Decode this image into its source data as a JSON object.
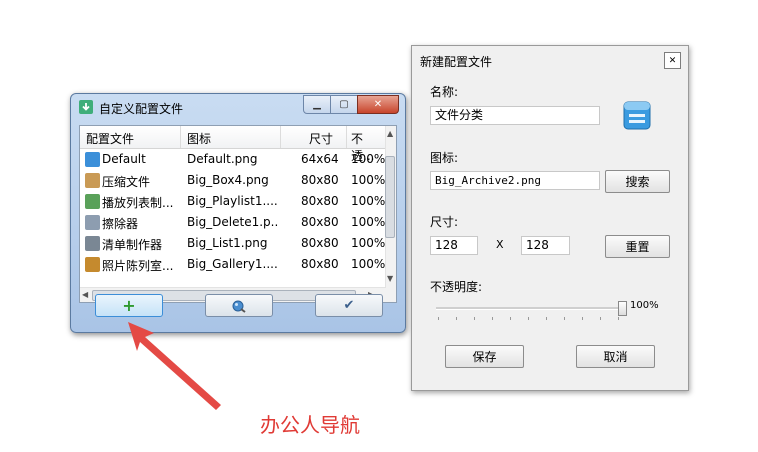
{
  "left_window": {
    "title": "自定义配置文件",
    "columns": [
      "配置文件",
      "图标",
      "尺寸",
      "不透..."
    ],
    "rows": [
      {
        "name": "Default",
        "icon_file": "Default.png",
        "size": "64x64",
        "opacity": "100%",
        "color": "#3b8fd9"
      },
      {
        "name": "压缩文件",
        "icon_file": "Big_Box4.png",
        "size": "80x80",
        "opacity": "100%",
        "color": "#c99a55"
      },
      {
        "name": "播放列表制...",
        "icon_file": "Big_Playlist1....",
        "size": "80x80",
        "opacity": "100%",
        "color": "#5aa15a"
      },
      {
        "name": "擦除器",
        "icon_file": "Big_Delete1.p...",
        "size": "80x80",
        "opacity": "100%",
        "color": "#8d9db0"
      },
      {
        "name": "清单制作器",
        "icon_file": "Big_List1.png",
        "size": "80x80",
        "opacity": "100%",
        "color": "#7a8794"
      },
      {
        "name": "照片陈列室...",
        "icon_file": "Big_Gallery1....",
        "size": "80x80",
        "opacity": "100%",
        "color": "#c58a2e"
      }
    ],
    "buttons": {
      "add": "+",
      "check": "✔"
    }
  },
  "dialog": {
    "title": "新建配置文件",
    "name_label": "名称:",
    "name_value": "文件分类",
    "icon_label": "图标:",
    "icon_value": "Big_Archive2.png",
    "search_button": "搜索",
    "size_label": "尺寸:",
    "width_value": "128",
    "x_sep": "X",
    "height_value": "128",
    "reset_button": "重置",
    "opacity_label": "不透明度:",
    "opacity_value": "100%",
    "opacity_level": 1.0,
    "save_button": "保存",
    "cancel_button": "取消"
  },
  "annotation": {
    "text": "办公人导航",
    "color": "#e03a35"
  }
}
